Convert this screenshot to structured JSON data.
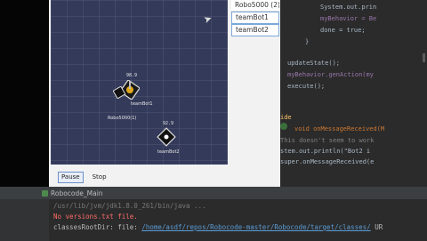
{
  "battle": {
    "robots_list": [
      "Robo5000 (2)",
      "teamBot1",
      "teamBot2"
    ],
    "robot1": {
      "name": "Robo5000(1)",
      "energy": "98.9"
    },
    "robot2": {
      "name": "teamBot1"
    },
    "robot3": {
      "name": "teamBot2",
      "energy": "92.9"
    },
    "pause_label": "Pause",
    "stop_label": "Stop"
  },
  "editor": {
    "lines": [
      {
        "text": "System.out.prin"
      },
      {
        "text": "myBehavior = Be"
      },
      {
        "text": "done = true;"
      },
      {
        "text": "}"
      },
      {
        "text": "updateState();"
      },
      {
        "text": "myBehavior.genAction(my"
      },
      {
        "text": "execute();"
      },
      {
        "text": "ide"
      },
      {
        "text": "void onMessageReceived(M"
      },
      {
        "text": "This doesn't seem to work"
      },
      {
        "text": "stem.out.println(\"Bot2 i"
      },
      {
        "text": "super.onMessageReceived(e"
      }
    ]
  },
  "run": {
    "tab_label": "Robocode_Main",
    "output": [
      "/usr/lib/jvm/jdk1.8.0_261/bin/java ...",
      "No versions.txt file.",
      "classesRootDir: file:",
      "/home/asdf/repos/Robocode-master/Robocode/target/classes/",
      "UR"
    ]
  }
}
